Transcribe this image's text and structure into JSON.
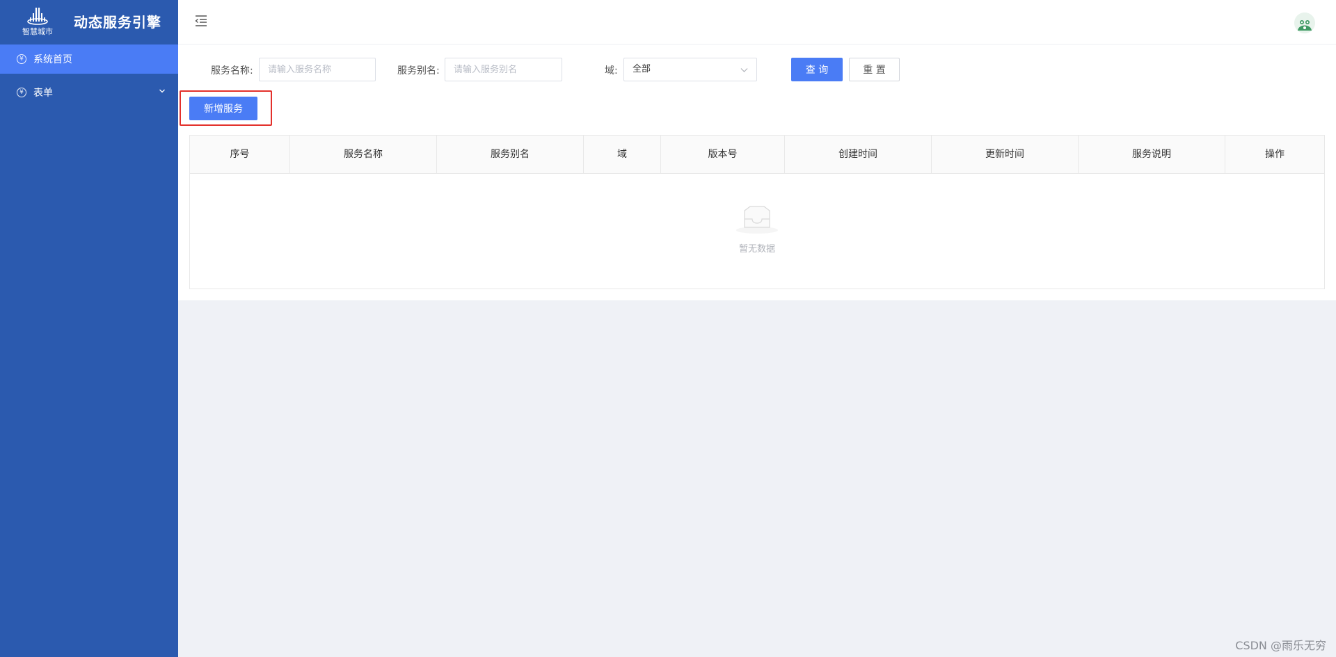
{
  "sidebar": {
    "logo_text": "智慧城市",
    "app_title": "动态服务引擎",
    "items": [
      {
        "label": "系统首页",
        "active": true
      },
      {
        "label": "表单",
        "active": false
      }
    ]
  },
  "search": {
    "service_name_label": "服务名称:",
    "service_name_placeholder": "请输入服务名称",
    "service_alias_label": "服务别名:",
    "service_alias_placeholder": "请输入服务别名",
    "domain_label": "域:",
    "domain_value": "全部",
    "query_label": "查 询",
    "reset_label": "重 置"
  },
  "toolbar": {
    "add_label": "新增服务"
  },
  "table": {
    "columns": [
      "序号",
      "服务名称",
      "服务别名",
      "域",
      "版本号",
      "创建时间",
      "更新时间",
      "服务说明",
      "操作"
    ],
    "empty_text": "暂无数据"
  },
  "watermark": "CSDN @雨乐无穷",
  "colors": {
    "sidebar_bg": "#2b5aaf",
    "primary": "#4a7cf5",
    "highlight_border": "#e3302b"
  }
}
